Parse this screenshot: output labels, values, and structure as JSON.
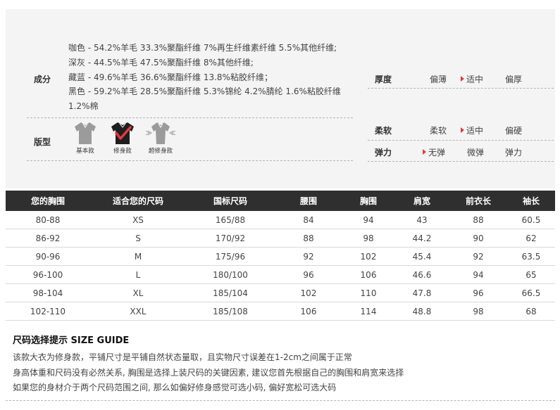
{
  "composition": {
    "label": "成分",
    "lines": [
      "咖色 - 54.2%羊毛 33.3%聚酯纤维 7%再生纤维素纤维 5.5%其他纤维;",
      "深灰 - 44.5%羊毛 47.5%聚酯纤维 8%其他纤维;",
      "藏蓝 - 49.6%羊毛 36.6%聚酯纤维 13.8%粘胶纤维；",
      "黑色 - 59.2%羊毛 28.5%聚酯纤维 5.3%锦纶 4.2%腈纶 1.6%粘胶纤维 1.2%棉"
    ]
  },
  "fit": {
    "label": "版型",
    "options": [
      {
        "label": "基本款",
        "selected": false
      },
      {
        "label": "修身款",
        "selected": true
      },
      {
        "label": "超修身款",
        "selected": false
      }
    ]
  },
  "attributes": {
    "thickness": {
      "name": "厚度",
      "options": [
        "偏薄",
        "适中",
        "偏厚"
      ],
      "selected_index": 1
    },
    "softness": {
      "name": "柔软",
      "options": [
        "柔软",
        "适中",
        "偏硬"
      ],
      "selected_index": 1
    },
    "elasticity": {
      "name": "弹力",
      "options": [
        "无弹",
        "微弹",
        "弹力"
      ],
      "selected_index": 0
    }
  },
  "colors": {
    "selected_marker": "#e4393c",
    "table_header_bg": "#2f2f2f",
    "panel_bg": "#f4f4f4"
  },
  "size_table": {
    "headers": [
      "您的胸围",
      "适合您的尺码",
      "国标尺码",
      "腰围",
      "胸围",
      "肩宽",
      "前衣长",
      "袖长"
    ],
    "rows": [
      [
        "80-88",
        "XS",
        "165/88",
        "84",
        "94",
        "43",
        "88",
        "60.5"
      ],
      [
        "86-92",
        "S",
        "170/92",
        "88",
        "98",
        "44.2",
        "90",
        "62"
      ],
      [
        "90-96",
        "M",
        "175/96",
        "92",
        "102",
        "45.4",
        "92",
        "63.5"
      ],
      [
        "96-100",
        "L",
        "180/100",
        "96",
        "106",
        "46.6",
        "94",
        "65"
      ],
      [
        "98-104",
        "XL",
        "185/104",
        "102",
        "110",
        "47.8",
        "96",
        "66.5"
      ],
      [
        "102-110",
        "XXL",
        "185/108",
        "106",
        "114",
        "48.8",
        "98",
        "68"
      ]
    ]
  },
  "size_guide": {
    "title": "尺码选择提示 SIZE GUIDE",
    "lines": [
      "该款大衣为修身款，平铺尺寸是平铺自然状态量取，且实物尺寸误差在1-2cm之间属于正常",
      "身高体重和尺码没有必然关系, 胸围是选择上装尺码的关键因素, 建议您首先根据自己的胸围和肩宽来选择",
      "如果您的身材介于两个尺码范围之间, 那么如偏好修身感觉可选小码, 偏好宽松可选大码"
    ]
  }
}
